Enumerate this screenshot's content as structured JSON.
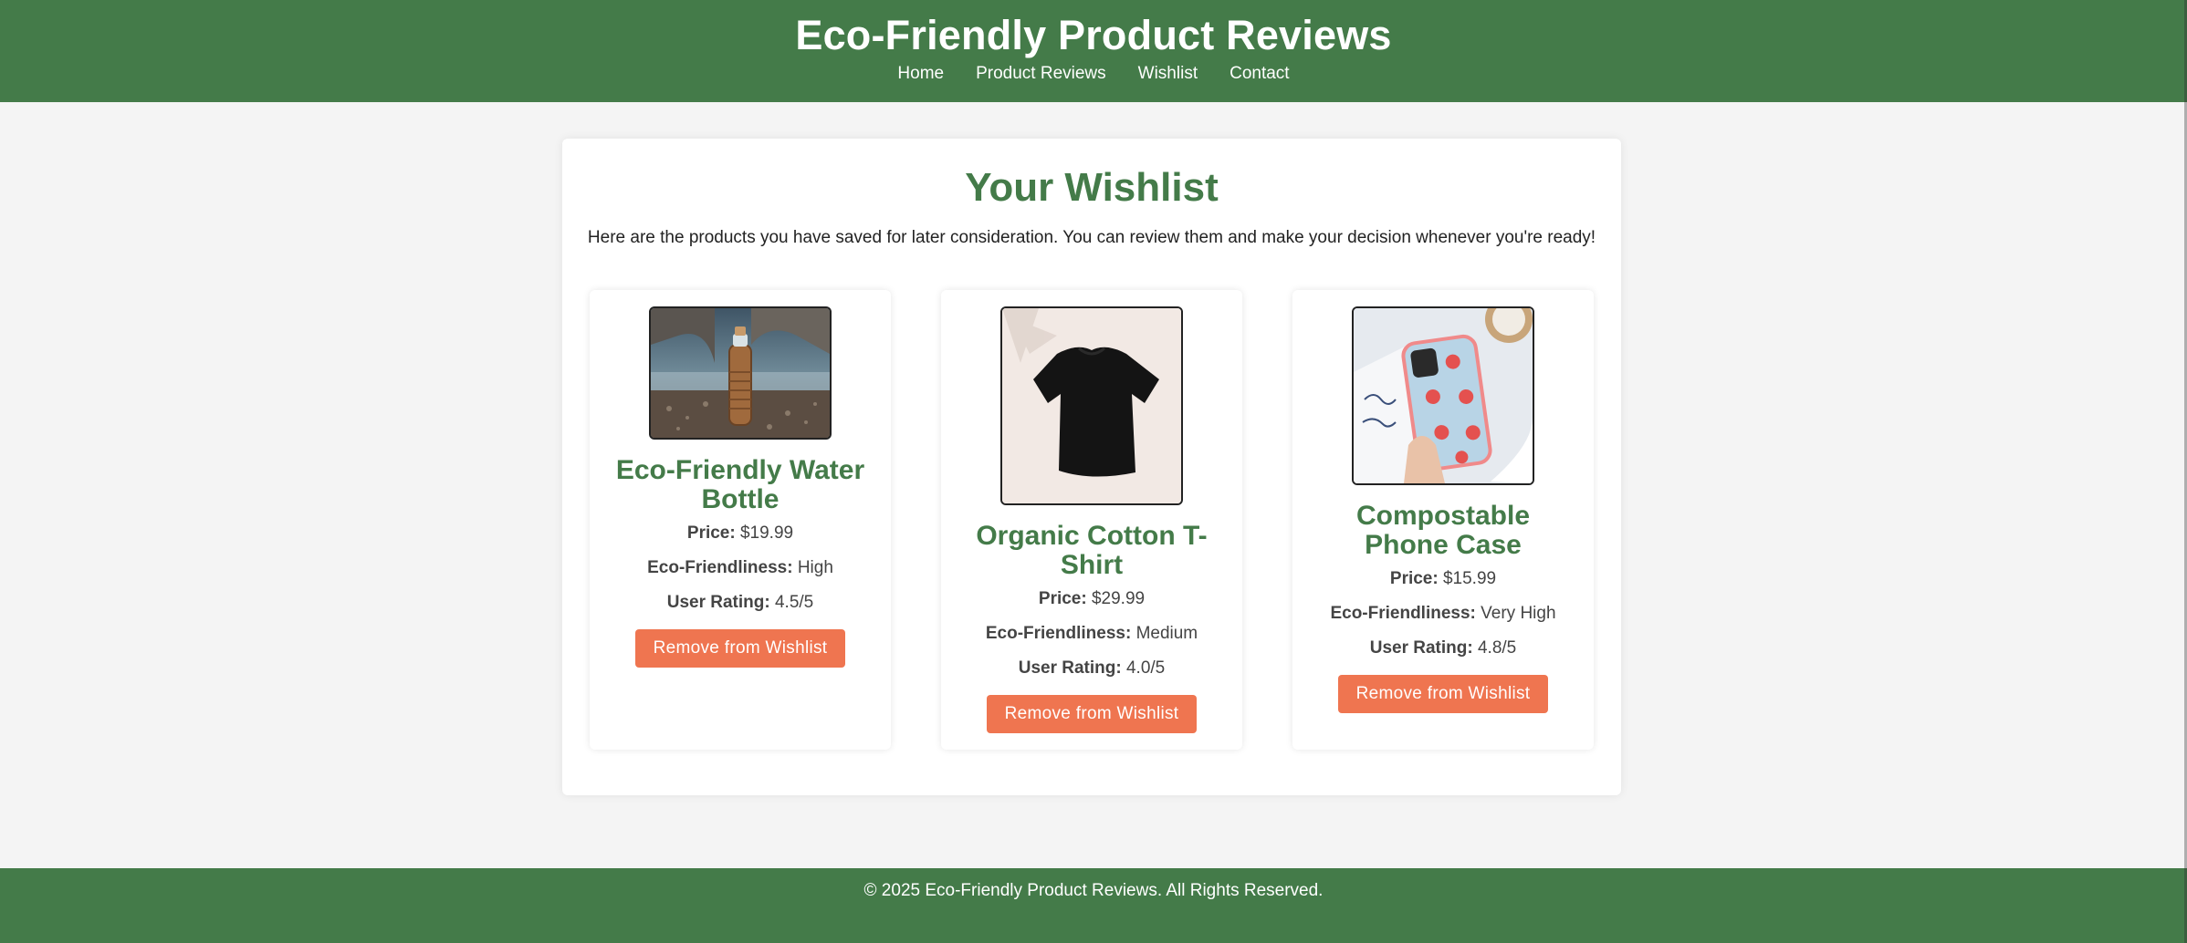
{
  "header": {
    "title": "Eco-Friendly Product Reviews",
    "nav": [
      "Home",
      "Product Reviews",
      "Wishlist",
      "Contact"
    ]
  },
  "wishlist": {
    "title": "Your Wishlist",
    "intro": "Here are the products you have saved for later consideration. You can review them and make your decision whenever you're ready!"
  },
  "products": [
    {
      "name": "Eco-Friendly Water Bottle",
      "price_label": "Price:",
      "price": "$19.99",
      "eco_label": "Eco-Friendliness:",
      "eco": "High",
      "rating_label": "User Rating:",
      "rating": "4.5/5",
      "button": "Remove from Wishlist"
    },
    {
      "name": "Organic Cotton T-Shirt",
      "price_label": "Price:",
      "price": "$29.99",
      "eco_label": "Eco-Friendliness:",
      "eco": "Medium",
      "rating_label": "User Rating:",
      "rating": "4.0/5",
      "button": "Remove from Wishlist"
    },
    {
      "name": "Compostable Phone Case",
      "price_label": "Price:",
      "price": "$15.99",
      "eco_label": "Eco-Friendliness:",
      "eco": "Very High",
      "rating_label": "User Rating:",
      "rating": "4.8/5",
      "button": "Remove from Wishlist"
    }
  ],
  "footer": {
    "text": "© 2025 Eco-Friendly Product Reviews. All Rights Reserved."
  },
  "colors": {
    "brand_green": "#447b49",
    "button_orange": "#ef7550",
    "page_bg": "#f4f4f4"
  }
}
